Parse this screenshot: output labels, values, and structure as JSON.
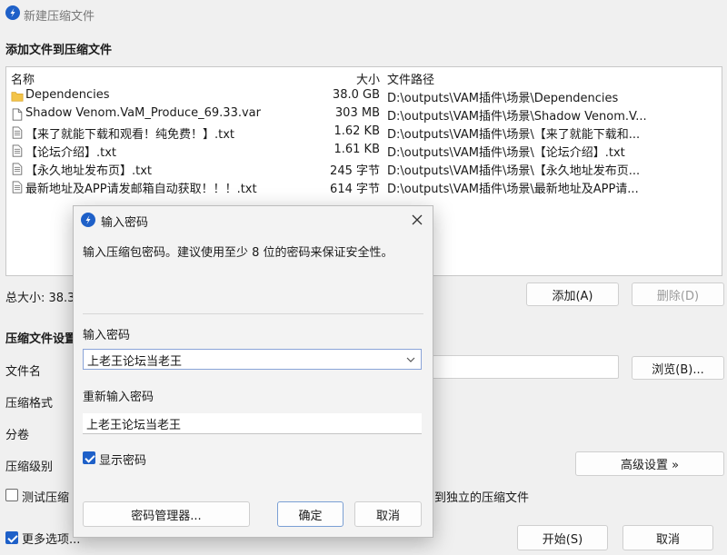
{
  "window": {
    "title": "新建压缩文件"
  },
  "add_section": {
    "title": "添加文件到压缩文件"
  },
  "file_list": {
    "columns": {
      "name": "名称",
      "size": "大小",
      "path": "文件路径"
    },
    "rows": [
      {
        "icon": "folder-icon",
        "name": "Dependencies",
        "size": "38.0 GB",
        "path": "D:\\outputs\\VAM插件\\场景\\Dependencies"
      },
      {
        "icon": "file-icon",
        "name": "Shadow Venom.VaM_Produce_69.33.var",
        "size": "303 MB",
        "path": "D:\\outputs\\VAM插件\\场景\\Shadow Venom.V..."
      },
      {
        "icon": "text-file-icon",
        "name": "【来了就能下载和观看！纯免费！】.txt",
        "size": "1.62 KB",
        "path": "D:\\outputs\\VAM插件\\场景\\【来了就能下载和..."
      },
      {
        "icon": "text-file-icon",
        "name": "【论坛介绍】.txt",
        "size": "1.61 KB",
        "path": "D:\\outputs\\VAM插件\\场景\\【论坛介绍】.txt"
      },
      {
        "icon": "text-file-icon",
        "name": "【永久地址发布页】.txt",
        "size": "245 字节",
        "path": "D:\\outputs\\VAM插件\\场景\\【永久地址发布页..."
      },
      {
        "icon": "text-file-icon",
        "name": "最新地址及APP请发邮箱自动获取！！！.txt",
        "size": "614 字节",
        "path": "D:\\outputs\\VAM插件\\场景\\最新地址及APP请..."
      }
    ]
  },
  "total_size": "总大小: 38.3",
  "buttons": {
    "add": "添加(A)",
    "remove": "删除(D)",
    "browse": "浏览(B)...",
    "advanced": "高级设置 »",
    "start": "开始(S)",
    "cancel": "取消"
  },
  "settings_section": {
    "title": "压缩文件设置"
  },
  "labels": {
    "file_name": "文件名",
    "format": "压缩格式",
    "split": "分卷",
    "level": "压缩级别"
  },
  "options": {
    "test": "测试压缩",
    "separate_suffix": "到独立的压缩文件",
    "more": "更多选项..."
  },
  "dialog": {
    "title": "输入密码",
    "description": "输入压缩包密码。建议使用至少 8 位的密码来保证安全性。",
    "password_label": "输入密码",
    "password_value": "上老王论坛当老王",
    "reenter_label": "重新输入密码",
    "reenter_value": "上老王论坛当老王",
    "show_password": "显示密码",
    "manager_button": "密码管理器...",
    "ok_button": "确定",
    "cancel_button": "取消"
  },
  "colors": {
    "accent": "#1e60c8",
    "folder": "#f3c449"
  }
}
